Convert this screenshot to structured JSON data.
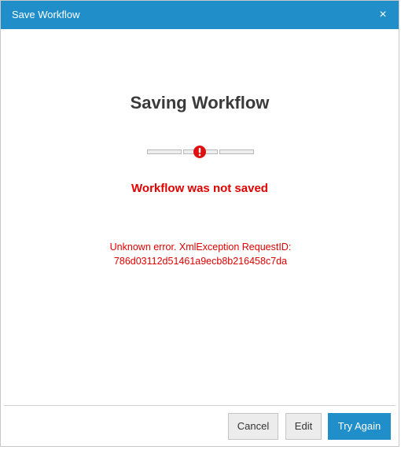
{
  "dialog": {
    "title": "Save Workflow",
    "close_label": "×",
    "heading": "Saving Workflow",
    "status": "Workflow was not saved",
    "error_lines": [
      "Unknown error. XmlException RequestID:",
      "786d03112d51461a9ecb8b216458c7da"
    ]
  },
  "progress": {
    "segments": 3,
    "state": "error",
    "icon": "error-exclamation-icon"
  },
  "buttons": {
    "cancel": "Cancel",
    "edit": "Edit",
    "try_again": "Try Again"
  },
  "colors": {
    "accent": "#1f8ec9",
    "error": "#e00000",
    "title_text": "#ffffff"
  }
}
